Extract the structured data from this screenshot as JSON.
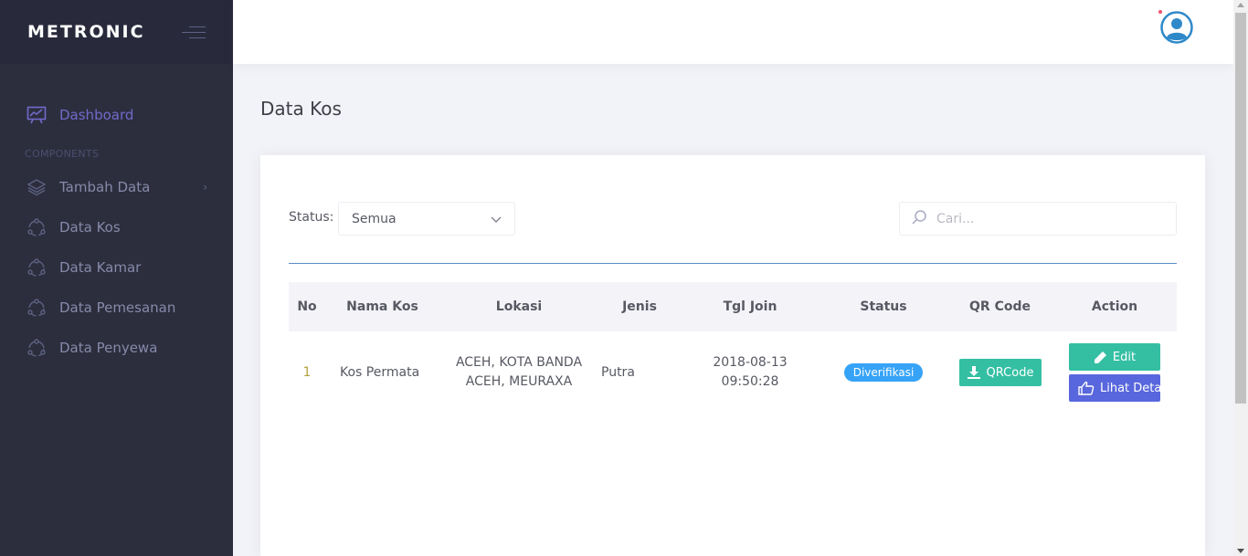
{
  "brand": {
    "name": "METRONIC"
  },
  "sidebar": {
    "items": [
      {
        "label": "Dashboard",
        "icon": "chart-icon",
        "active": true
      },
      {
        "label": "Tambah Data",
        "icon": "layers-icon"
      },
      {
        "label": "Data Kos",
        "icon": "circle-nodes-icon"
      },
      {
        "label": "Data Kamar",
        "icon": "circle-nodes-icon"
      },
      {
        "label": "Data Pemesanan",
        "icon": "circle-nodes-icon"
      },
      {
        "label": "Data Penyewa",
        "icon": "circle-nodes-icon"
      }
    ],
    "section_label": "COMPONENTS"
  },
  "page": {
    "title": "Data Kos"
  },
  "filters": {
    "status_label": "Status:",
    "status_value": "Semua",
    "search_placeholder": "Cari..."
  },
  "table": {
    "headers": [
      "No",
      "Nama Kos",
      "Lokasi",
      "Jenis",
      "Tgl Join",
      "Status",
      "QR Code",
      "Action"
    ],
    "rows": [
      {
        "no": "1",
        "nama": "Kos Permata",
        "lokasi_line1": "ACEH, KOTA BANDA",
        "lokasi_line2": "ACEH, MEURAXA",
        "jenis": "Putra",
        "tgl_line1": "2018-08-13",
        "tgl_line2": "09:50:28",
        "status": "Diverifikasi",
        "qr_label": "QRCode",
        "edit_label": "Edit",
        "detail_label": "Lihat Detail"
      }
    ]
  },
  "colors": {
    "sidebar_bg": "#2c2e3e",
    "brand_bg": "#282a3c",
    "accent": "#716aca",
    "success": "#34bfa3",
    "info": "#36a3f7",
    "primary": "#5867dd"
  }
}
